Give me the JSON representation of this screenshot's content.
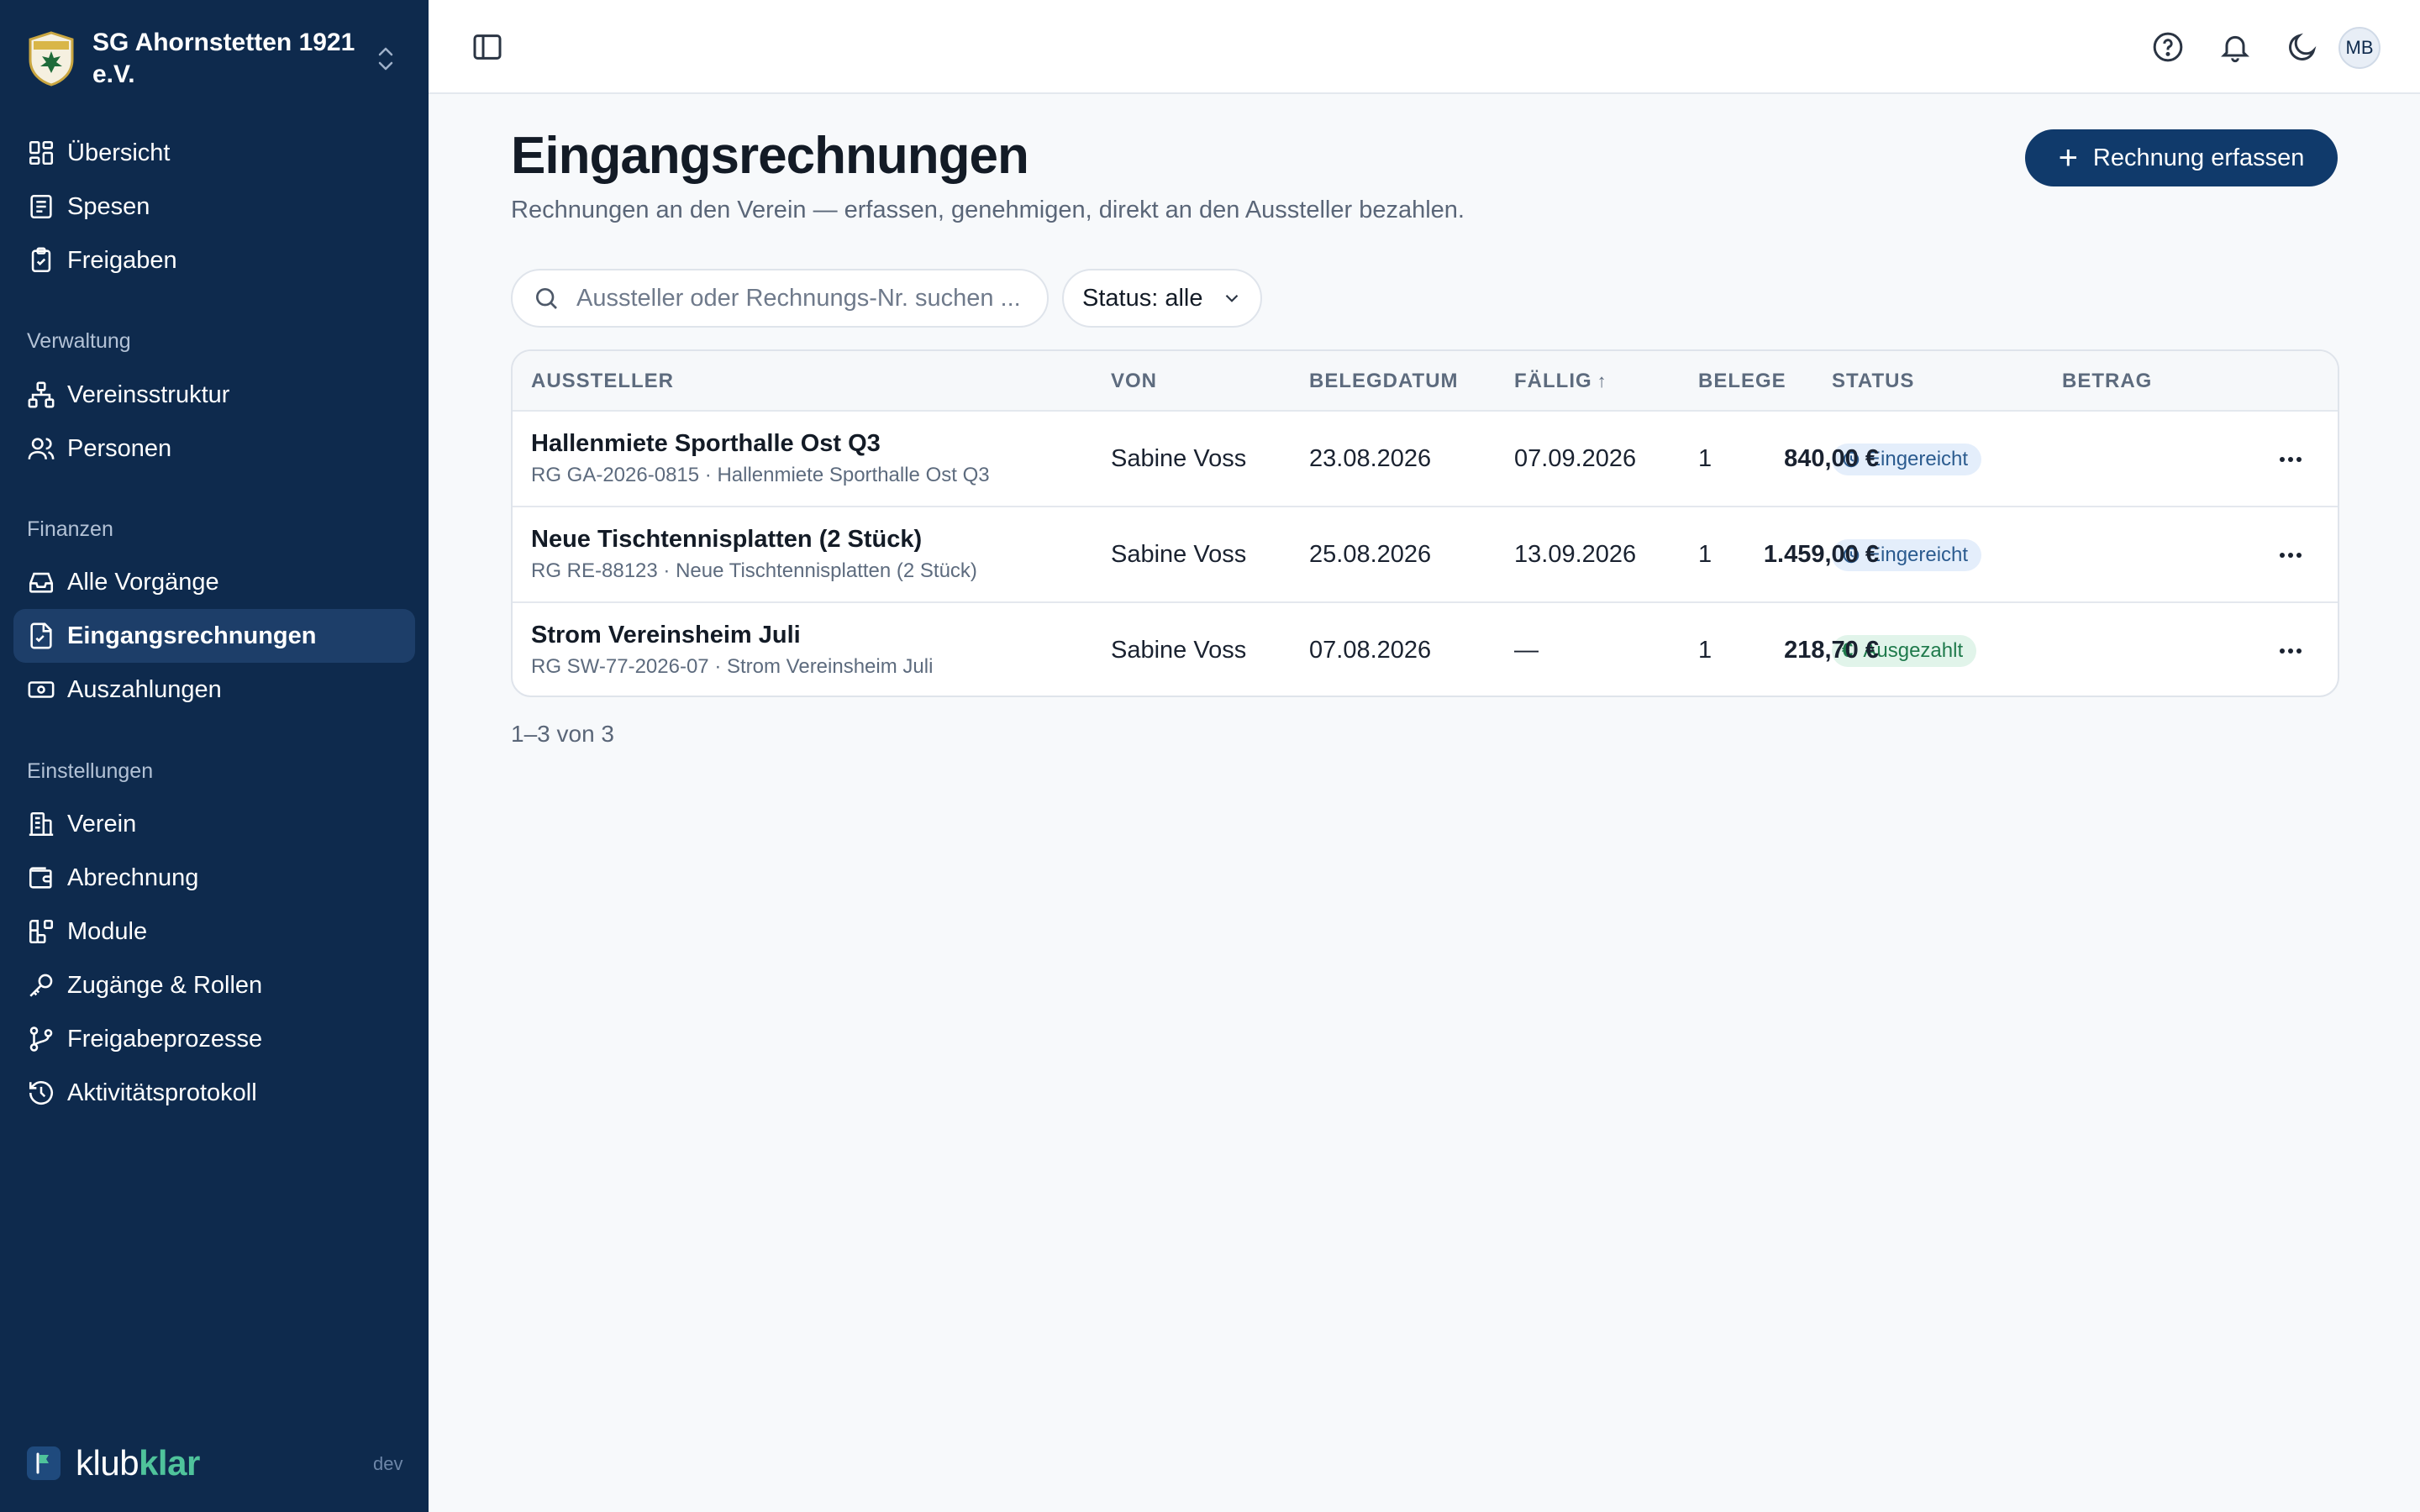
{
  "sidebar": {
    "club_name": "SG Ahornstetten 1921 e.V.",
    "top_items": [
      {
        "label": "Übersicht",
        "icon": "dashboard-icon"
      },
      {
        "label": "Spesen",
        "icon": "receipt-icon"
      },
      {
        "label": "Freigaben",
        "icon": "clipboard-check-icon"
      }
    ],
    "groups": [
      {
        "label": "Verwaltung",
        "items": [
          {
            "label": "Vereinsstruktur",
            "icon": "hierarchy-icon"
          },
          {
            "label": "Personen",
            "icon": "users-icon"
          }
        ]
      },
      {
        "label": "Finanzen",
        "items": [
          {
            "label": "Alle Vorgänge",
            "icon": "inbox-icon"
          },
          {
            "label": "Eingangsrechnungen",
            "icon": "file-invoice-icon",
            "active": true
          },
          {
            "label": "Auszahlungen",
            "icon": "banknote-icon"
          }
        ]
      },
      {
        "label": "Einstellungen",
        "items": [
          {
            "label": "Verein",
            "icon": "building-icon"
          },
          {
            "label": "Abrechnung",
            "icon": "wallet-icon"
          },
          {
            "label": "Module",
            "icon": "modules-icon"
          },
          {
            "label": "Zugänge & Rollen",
            "icon": "key-icon"
          },
          {
            "label": "Freigabeprozesse",
            "icon": "git-branch-icon"
          },
          {
            "label": "Aktivitätsprotokoll",
            "icon": "history-icon"
          }
        ]
      }
    ],
    "brand": {
      "part1": "klub",
      "part2": "klar"
    },
    "env": "dev"
  },
  "topbar": {
    "avatar_initials": "MB"
  },
  "page": {
    "title": "Eingangsrechnungen",
    "subtitle": "Rechnungen an den Verein — erfassen, genehmigen, direkt an den Aussteller bezahlen.",
    "primary_button": "Rechnung erfassen",
    "search_placeholder": "Aussteller oder Rechnungs-Nr. suchen ...",
    "status_filter": "Status: alle"
  },
  "table": {
    "columns": {
      "aussteller": "AUSSTELLER",
      "von": "VON",
      "belegdatum": "BELEGDATUM",
      "faellig": "FÄLLIG",
      "faellig_sort": "↑",
      "belege": "BELEGE",
      "status": "STATUS",
      "betrag": "BETRAG"
    },
    "rows": [
      {
        "title": "Hallenmiete Sporthalle Ost Q3",
        "sub": "RG GA-2026-0815 · Hallenmiete Sporthalle Ost Q3",
        "von": "Sabine Voss",
        "belegdatum": "23.08.2026",
        "faellig": "07.09.2026",
        "belege": "1",
        "status": "Eingereicht",
        "status_kind": "submitted",
        "betrag": "840,00 €"
      },
      {
        "title": "Neue Tischtennisplatten (2 Stück)",
        "sub": "RG RE-88123 · Neue Tischtennisplatten (2 Stück)",
        "von": "Sabine Voss",
        "belegdatum": "25.08.2026",
        "faellig": "13.09.2026",
        "belege": "1",
        "status": "Eingereicht",
        "status_kind": "submitted",
        "betrag": "1.459,00 €"
      },
      {
        "title": "Strom Vereinsheim Juli",
        "sub": "RG SW-77-2026-07 · Strom Vereinsheim Juli",
        "von": "Sabine Voss",
        "belegdatum": "07.08.2026",
        "faellig": "—",
        "belege": "1",
        "status": "Ausgezahlt",
        "status_kind": "paid",
        "betrag": "218,70 €"
      }
    ]
  },
  "pagination": "1–3 von 3",
  "colors": {
    "sidebar_bg": "#0e2a4d",
    "primary": "#103a6b",
    "accent": "#4fc39b",
    "badge_submitted": "#2b5b8f",
    "badge_paid": "#1f7a4c"
  }
}
